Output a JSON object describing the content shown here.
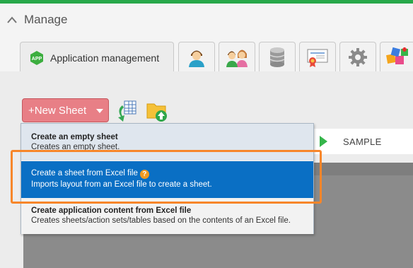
{
  "header": {
    "title": "Manage"
  },
  "tabs": [
    {
      "label": "Application management",
      "icon": "app-icon"
    },
    {
      "icon": "user-icon"
    },
    {
      "icon": "users-group-icon"
    },
    {
      "icon": "database-icon"
    },
    {
      "icon": "certificate-icon"
    },
    {
      "icon": "gear-icon"
    },
    {
      "icon": "plugin-blocks-icon"
    }
  ],
  "toolbar": {
    "new_sheet_label": "+New Sheet",
    "icons": [
      "table-import-icon",
      "folder-upload-icon"
    ]
  },
  "rightbar": {
    "sample_label": "SAMPLE"
  },
  "dropdown": {
    "items": [
      {
        "title": "Create an empty sheet",
        "desc": "Creates an empty sheet."
      },
      {
        "title": "Create a sheet from Excel file",
        "desc": "Imports layout from an Excel file to create a sheet.",
        "selected": true
      },
      {
        "title": "Create application content from Excel file",
        "desc": "Creates sheets/action sets/tables based on the contents of an Excel file."
      }
    ]
  },
  "colors": {
    "topbar": "#27a84a",
    "new_sheet_button": "#e87f86",
    "selected_item": "#0a6fc4",
    "highlight_border": "#f7862a",
    "help_badge": "#f39a1f"
  }
}
